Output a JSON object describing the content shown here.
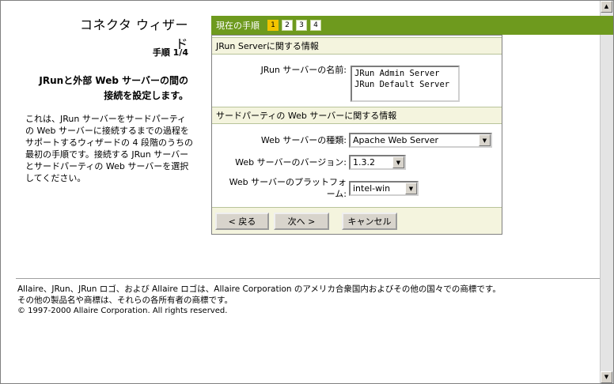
{
  "left": {
    "title": "コネクタ ウィザード",
    "step": "手順 1/4",
    "heading_line1": "JRunと外部 Web サーバーの間の",
    "heading_line2": "接続を設定します。",
    "description": "これは、JRun サーバーをサードパーティの Web サーバーに接続するまでの過程をサポートするウィザードの 4 段階のうちの最初の手順です。接続する JRun サーバーとサードパーティの Web サーバーを選択してください。"
  },
  "stepbar": {
    "label": "現在の手順",
    "steps": [
      "1",
      "2",
      "3",
      "4"
    ],
    "active_step": "1"
  },
  "jrun_section": {
    "header": "JRun Serverに関する情報",
    "server_name_label": "JRun サーバーの名前:",
    "servers": [
      "JRun Admin Server",
      "JRun Default Server"
    ]
  },
  "web_section": {
    "header": "サードパーティの Web サーバーに関する情報",
    "type_label": "Web サーバーの種類:",
    "type_value": "Apache Web Server",
    "version_label": "Web サーバーのバージョン:",
    "version_value": "1.3.2",
    "platform_label_line1": "Web サーバーのプラットフォ",
    "platform_label_line2": "ーム:",
    "platform_value": "intel-win"
  },
  "buttons": {
    "back": "< 戻る",
    "next": "次へ >",
    "cancel": "キャンセル"
  },
  "footer": {
    "line1": "Allaire、JRun、JRun ロゴ、および Allaire ロゴは、Allaire Corporation のアメリカ合衆国内およびその他の国々での商標です。",
    "line2": "その他の製品名や商標は、それらの各所有者の商標です。",
    "copyright": "© 1997-2000 Allaire Corporation. All rights reserved."
  },
  "colors": {
    "accent_green": "#6e9a1e",
    "active_step": "#f2c400",
    "section_bg": "#f4f4de"
  }
}
